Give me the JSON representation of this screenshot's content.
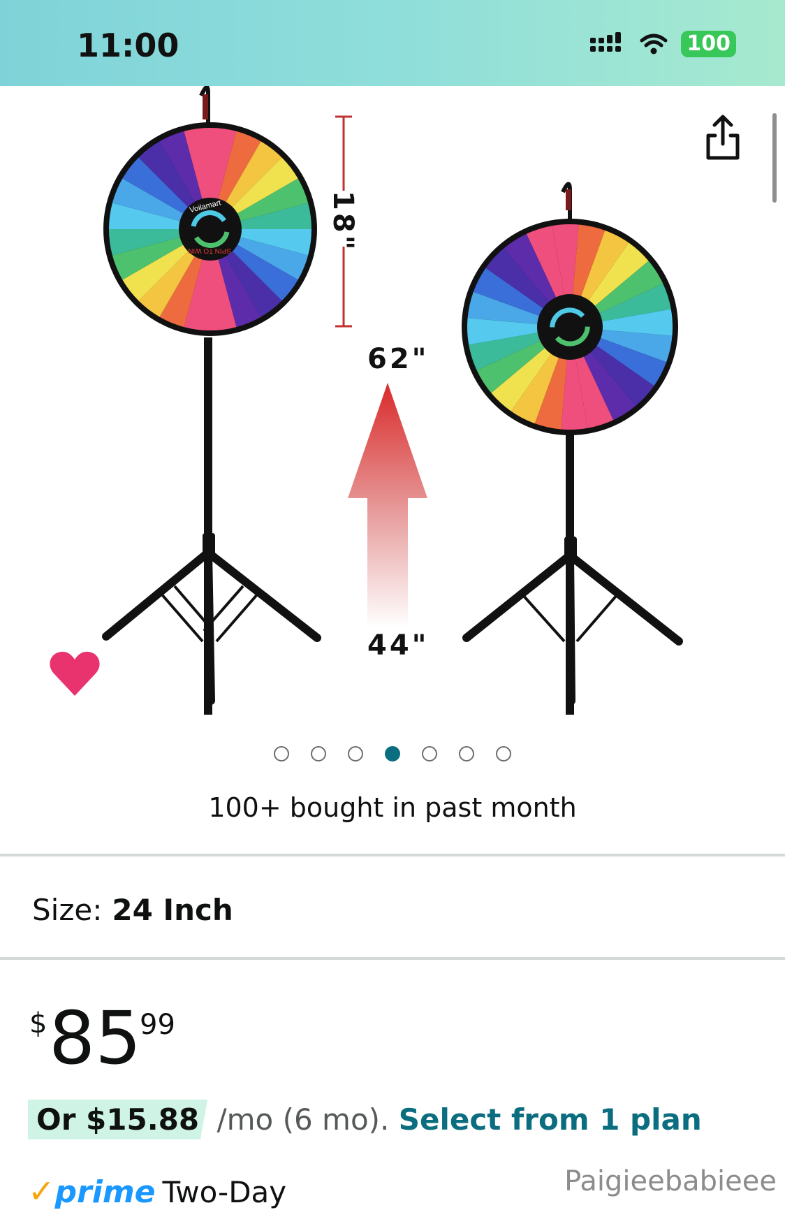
{
  "status_bar": {
    "time": "11:00",
    "battery": "100",
    "icons": [
      "signal-icon",
      "wifi-icon",
      "battery-icon"
    ]
  },
  "gallery": {
    "dimension_labels": {
      "wheel_diameter": "18\"",
      "max_height": "62\"",
      "min_height": "44\""
    },
    "wheel_brand": "Voilamart",
    "wheel_text": "SPIN TO WIN",
    "page_count": 7,
    "active_page": 4,
    "icons": [
      "share-icon",
      "heart-icon"
    ]
  },
  "social_proof": "100+ bought in past month",
  "size": {
    "label": "Size:",
    "value": "24 Inch"
  },
  "price": {
    "currency": "$",
    "whole": "85",
    "fraction": "99"
  },
  "installment": {
    "highlight": "Or $15.88",
    "rest": "/mo (6 mo).",
    "link": "Select from 1 plan"
  },
  "prime": {
    "check": "✓",
    "brand": "prime",
    "delivery": "Two-Day"
  },
  "watermark": "Paigieebabieee",
  "colors": {
    "accent_teal": "#0b6e80",
    "heart_pink": "#e8336f",
    "prime_blue": "#1a98ff",
    "highlight_mint": "#cff3e4"
  }
}
